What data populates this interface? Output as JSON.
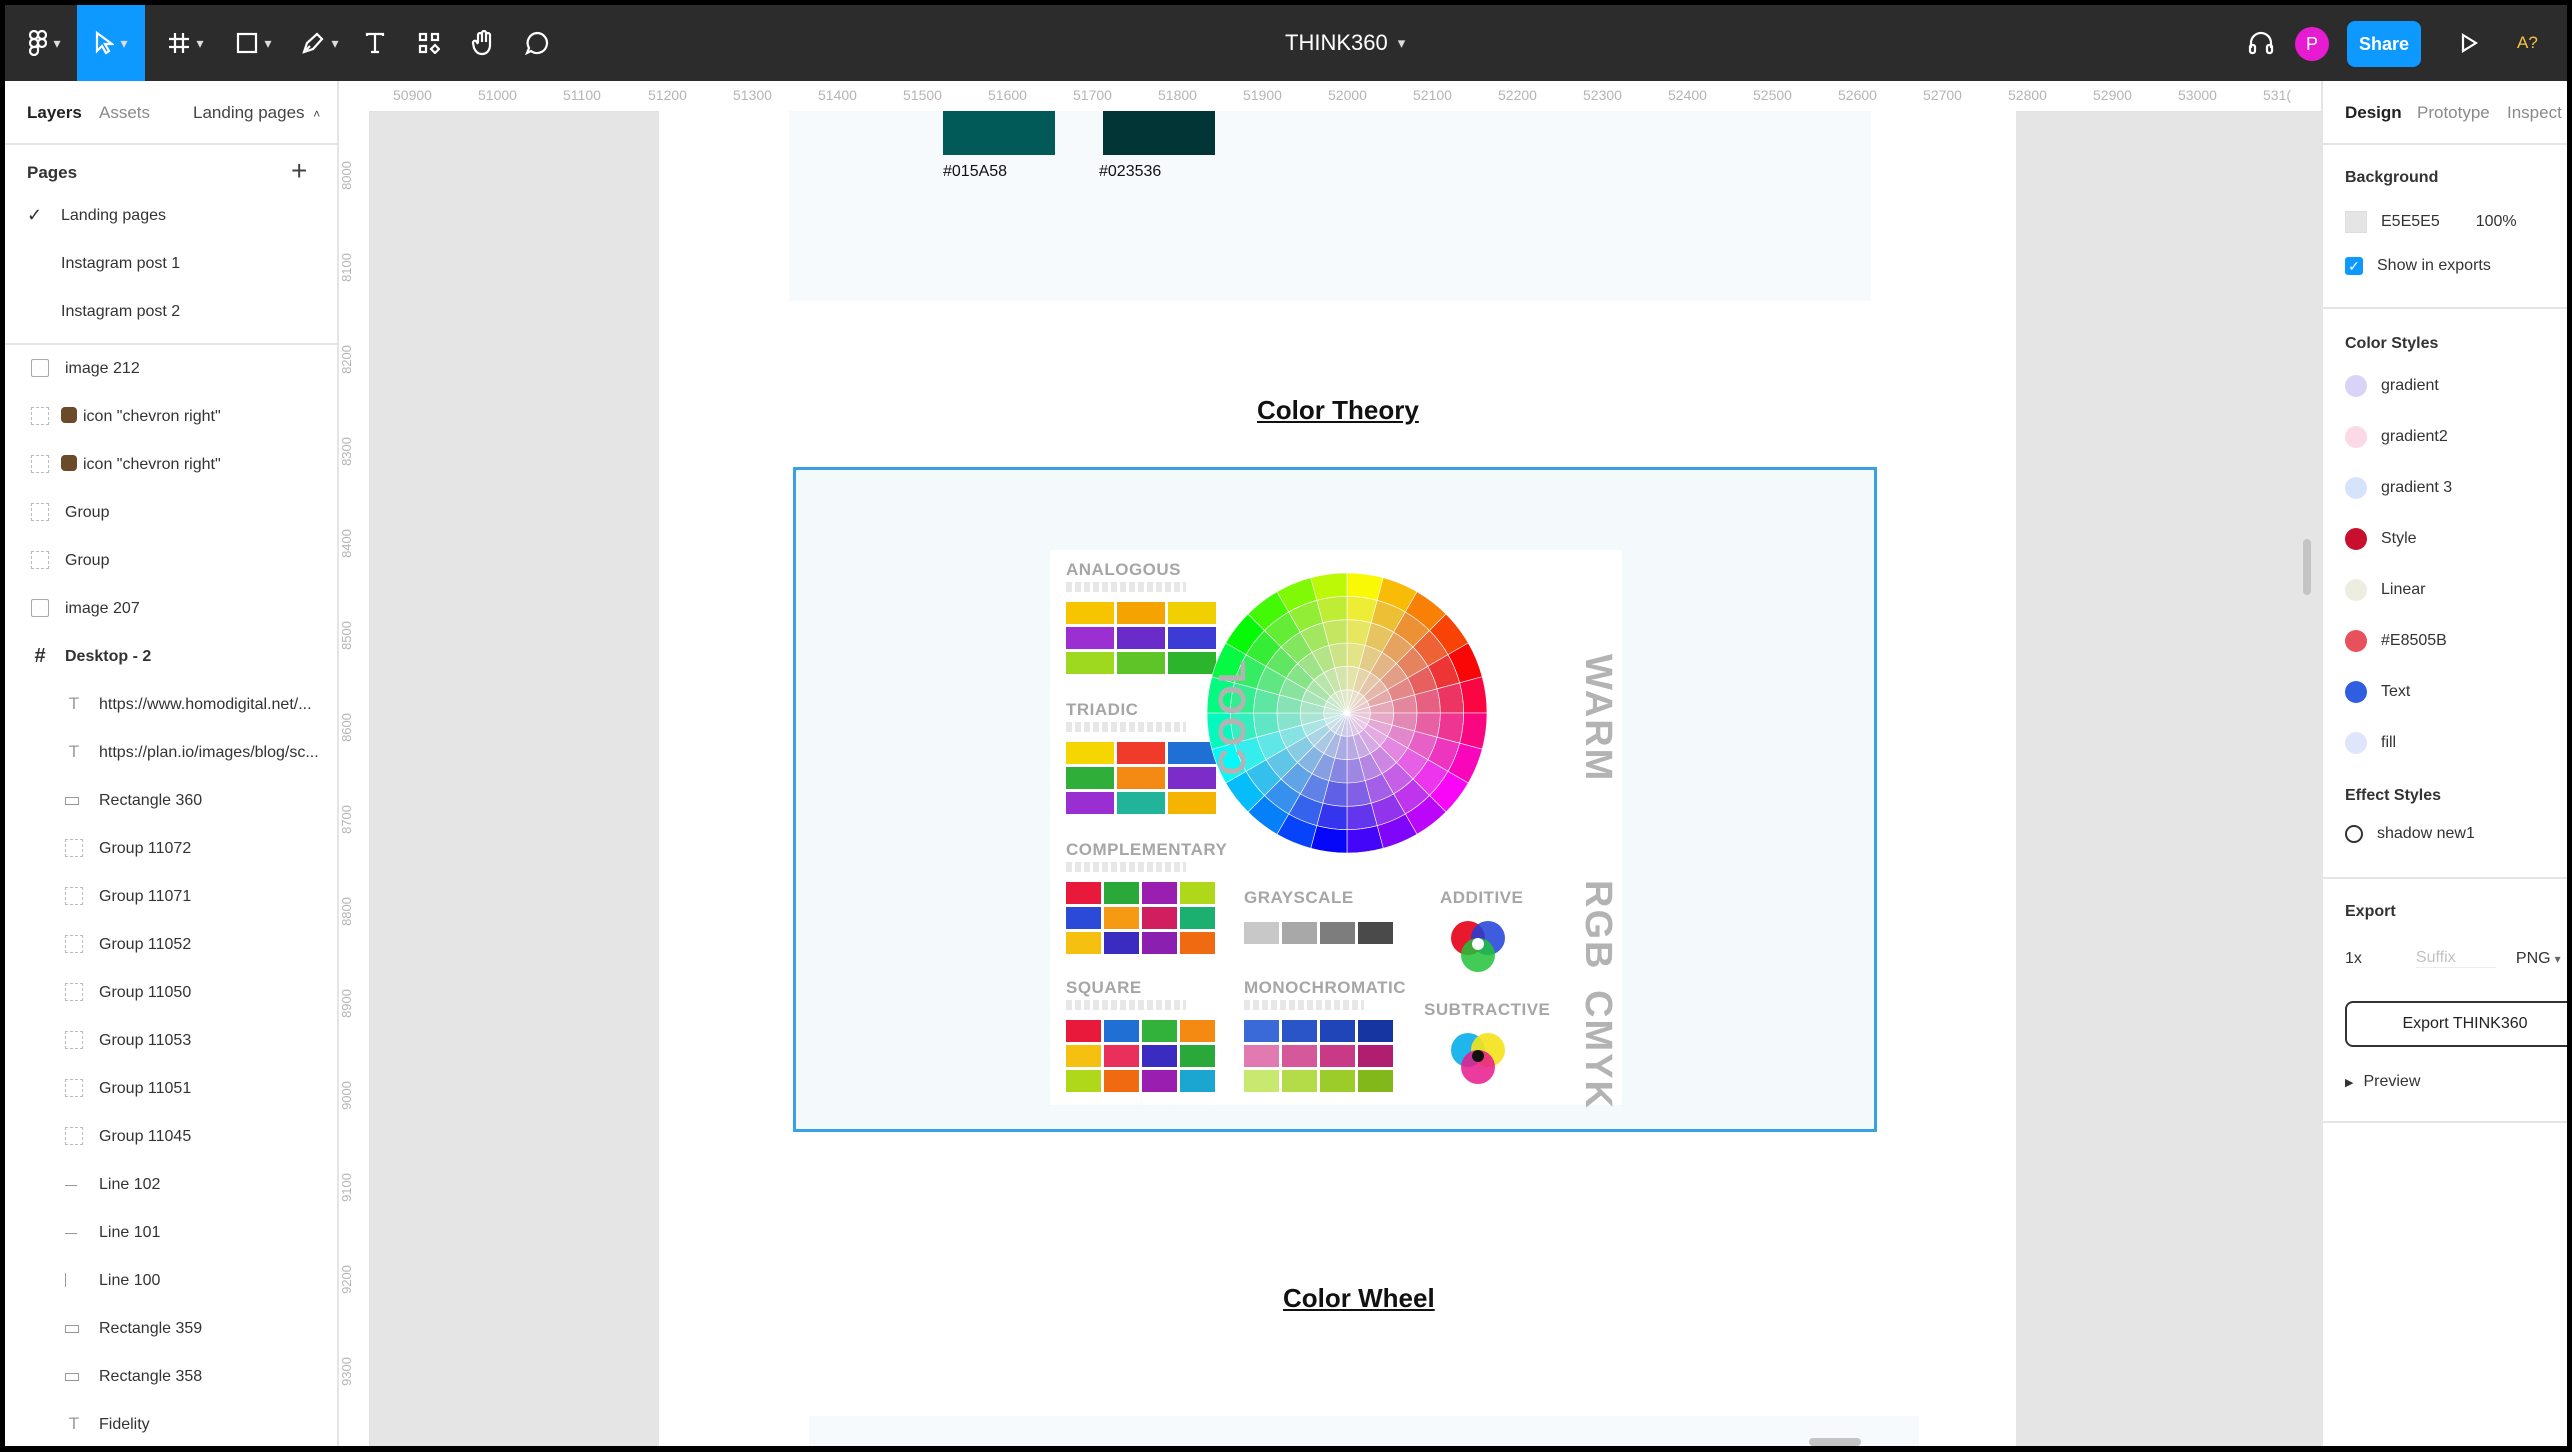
{
  "toolbar": {
    "document_title": "THINK360",
    "avatar_initial": "P",
    "share_label": "Share",
    "zoom_label": "A?",
    "icons": [
      "figma-menu-icon",
      "move-tool-icon",
      "frame-tool-icon",
      "shape-tool-icon",
      "pen-tool-icon",
      "text-tool-icon",
      "components-icon",
      "hand-tool-icon",
      "comment-tool-icon",
      "headphones-icon",
      "present-icon"
    ]
  },
  "left_panel": {
    "tabs": [
      "Layers",
      "Assets",
      "Landing pages"
    ],
    "pages_title": "Pages",
    "pages": [
      "Landing pages",
      "Instagram  post 1",
      "Instagram post 2"
    ],
    "layers": [
      {
        "label": "image 212",
        "icon": "image-icon",
        "indent": 0
      },
      {
        "label": "icon \"chevron right\"",
        "icon": "component-icon",
        "indent": 0
      },
      {
        "label": "icon \"chevron right\"",
        "icon": "component-icon",
        "indent": 0
      },
      {
        "label": "Group",
        "icon": "group-icon",
        "indent": 0
      },
      {
        "label": "Group",
        "icon": "group-icon",
        "indent": 0
      },
      {
        "label": "image 207",
        "icon": "image-icon",
        "indent": 0
      },
      {
        "label": "Desktop - 2",
        "icon": "frame-icon",
        "indent": 0
      },
      {
        "label": "https://www.homodigital.net/...",
        "icon": "text-icon",
        "indent": 1
      },
      {
        "label": "https://plan.io/images/blog/sc...",
        "icon": "text-icon",
        "indent": 1
      },
      {
        "label": "Rectangle 360",
        "icon": "rectangle-icon",
        "indent": 1
      },
      {
        "label": "Group 11072",
        "icon": "group-icon",
        "indent": 1
      },
      {
        "label": "Group 11071",
        "icon": "group-icon",
        "indent": 1
      },
      {
        "label": "Group 11052",
        "icon": "group-icon",
        "indent": 1
      },
      {
        "label": "Group 11050",
        "icon": "group-icon",
        "indent": 1
      },
      {
        "label": "Group 11053",
        "icon": "group-icon",
        "indent": 1
      },
      {
        "label": "Group 11051",
        "icon": "group-icon",
        "indent": 1
      },
      {
        "label": "Group 11045",
        "icon": "group-icon",
        "indent": 1
      },
      {
        "label": "Line 102",
        "icon": "line-icon",
        "indent": 1
      },
      {
        "label": "Line 101",
        "icon": "line-icon",
        "indent": 1
      },
      {
        "label": "Line 100",
        "icon": "vline-icon",
        "indent": 1
      },
      {
        "label": "Rectangle 359",
        "icon": "rectangle-icon",
        "indent": 1
      },
      {
        "label": "Rectangle 358",
        "icon": "rectangle-icon",
        "indent": 1
      },
      {
        "label": "Fidelity",
        "icon": "text-icon",
        "indent": 1
      }
    ]
  },
  "rulers": {
    "top": [
      "50900",
      "51000",
      "51100",
      "51200",
      "51300",
      "51400",
      "51500",
      "51600",
      "51700",
      "51800",
      "51900",
      "52000",
      "52100",
      "52200",
      "52300",
      "52400",
      "52500",
      "52600",
      "52700",
      "52800",
      "52900",
      "53000",
      "531("
    ],
    "left": [
      "8000",
      "8100",
      "8200",
      "8300",
      "8400",
      "8500",
      "8600",
      "8700",
      "8800",
      "8900",
      "9000",
      "9100",
      "9200",
      "9300"
    ]
  },
  "canvas": {
    "swatches": [
      {
        "hex": "#015A58",
        "label": "#015A58"
      },
      {
        "hex": "#023536",
        "label": "#023536"
      }
    ],
    "heading_color_theory": "Color Theory",
    "heading_color_wheel": "Color Wheel",
    "infographic": {
      "analogous": "ANALOGOUS",
      "triadic": "TRIADIC",
      "complementary": "COMPLEMENTARY",
      "square": "SQUARE",
      "grayscale": "GRAYSCALE",
      "monochromatic": "MONOCHROMATIC",
      "additive": "ADDITIVE",
      "subtractive": "SUBTRACTIVE",
      "cool": "COOL",
      "warm": "WARM",
      "rgb": "RGB",
      "cmyk": "CMYK"
    }
  },
  "right_panel": {
    "tabs": [
      "Design",
      "Prototype",
      "Inspect"
    ],
    "background_title": "Background",
    "background_hex": "E5E5E5",
    "background_opacity": "100%",
    "background_color": "#E5E5E5",
    "show_in_exports": "Show in exports",
    "color_styles_title": "Color Styles",
    "color_styles": [
      {
        "name": "gradient",
        "color": "#d9d4f7"
      },
      {
        "name": "gradient2",
        "color": "#fbd9e6"
      },
      {
        "name": "gradient 3",
        "color": "#d6e4fb"
      },
      {
        "name": "Style",
        "color": "#c8102e"
      },
      {
        "name": "Linear",
        "color": "#eeeee0"
      },
      {
        "name": "#E8505B",
        "color": "#e8505b"
      },
      {
        "name": "Text",
        "color": "#2f5fe0"
      },
      {
        "name": "fill",
        "color": "#dfe6fb"
      }
    ],
    "effect_styles_title": "Effect Styles",
    "effect_style_name": "shadow new1",
    "export_title": "Export",
    "export_scale": "1x",
    "export_suffix_placeholder": "Suffix",
    "export_format": "PNG",
    "export_button": "Export THINK360",
    "preview_label": "Preview"
  }
}
